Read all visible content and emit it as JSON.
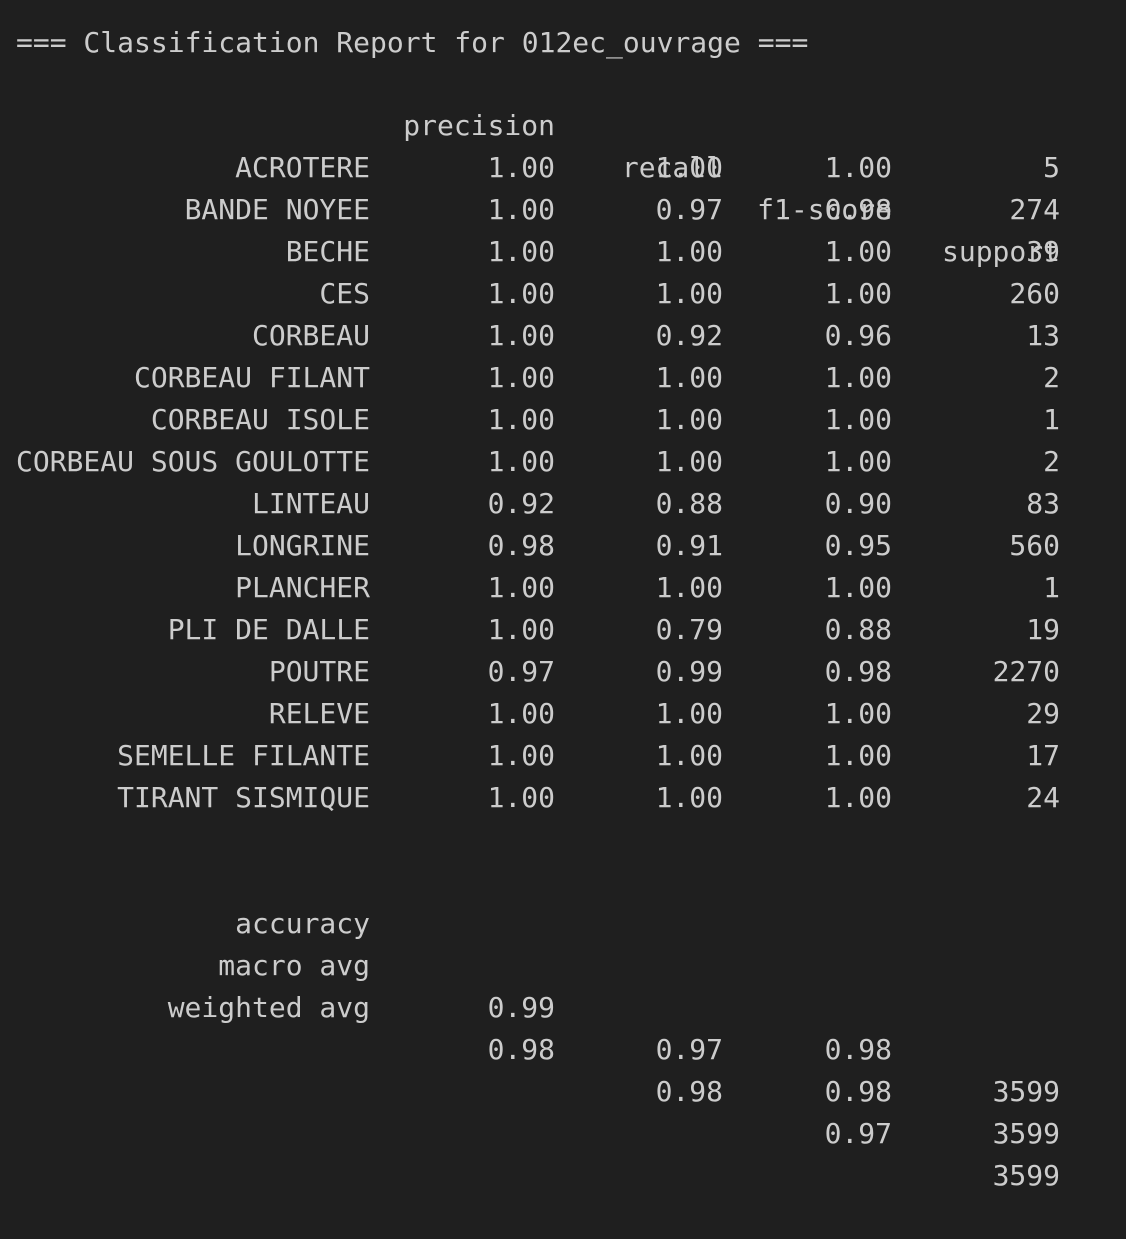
{
  "title": "=== Classification Report for 012ec_ouvrage ===",
  "headers": {
    "precision": "precision",
    "recall": "recall",
    "f1": "f1-score",
    "support": "support"
  },
  "rows": [
    {
      "label": "ACROTERE",
      "precision": "1.00",
      "recall": "1.00",
      "f1": "1.00",
      "support": "5"
    },
    {
      "label": "BANDE NOYEE",
      "precision": "1.00",
      "recall": "0.97",
      "f1": "0.98",
      "support": "274"
    },
    {
      "label": "BECHE",
      "precision": "1.00",
      "recall": "1.00",
      "f1": "1.00",
      "support": "39"
    },
    {
      "label": "CES",
      "precision": "1.00",
      "recall": "1.00",
      "f1": "1.00",
      "support": "260"
    },
    {
      "label": "CORBEAU",
      "precision": "1.00",
      "recall": "0.92",
      "f1": "0.96",
      "support": "13"
    },
    {
      "label": "CORBEAU FILANT",
      "precision": "1.00",
      "recall": "1.00",
      "f1": "1.00",
      "support": "2"
    },
    {
      "label": "CORBEAU ISOLE",
      "precision": "1.00",
      "recall": "1.00",
      "f1": "1.00",
      "support": "1"
    },
    {
      "label": "CORBEAU SOUS GOULOTTE",
      "precision": "1.00",
      "recall": "1.00",
      "f1": "1.00",
      "support": "2"
    },
    {
      "label": "LINTEAU",
      "precision": "0.92",
      "recall": "0.88",
      "f1": "0.90",
      "support": "83"
    },
    {
      "label": "LONGRINE",
      "precision": "0.98",
      "recall": "0.91",
      "f1": "0.95",
      "support": "560"
    },
    {
      "label": "PLANCHER",
      "precision": "1.00",
      "recall": "1.00",
      "f1": "1.00",
      "support": "1"
    },
    {
      "label": "PLI DE DALLE",
      "precision": "1.00",
      "recall": "0.79",
      "f1": "0.88",
      "support": "19"
    },
    {
      "label": "POUTRE",
      "precision": "0.97",
      "recall": "0.99",
      "f1": "0.98",
      "support": "2270"
    },
    {
      "label": "RELEVE",
      "precision": "1.00",
      "recall": "1.00",
      "f1": "1.00",
      "support": "29"
    },
    {
      "label": "SEMELLE FILANTE",
      "precision": "1.00",
      "recall": "1.00",
      "f1": "1.00",
      "support": "17"
    },
    {
      "label": "TIRANT SISMIQUE",
      "precision": "1.00",
      "recall": "1.00",
      "f1": "1.00",
      "support": "24"
    }
  ],
  "summary": {
    "accuracy": {
      "label": "accuracy",
      "precision": "",
      "recall": "",
      "f1": "0.98",
      "support": "3599"
    },
    "macro": {
      "label": "macro avg",
      "precision": "0.99",
      "recall": "0.97",
      "f1": "0.98",
      "support": "3599"
    },
    "weighted": {
      "label": "weighted avg",
      "precision": "0.98",
      "recall": "0.98",
      "f1": "0.97",
      "support": "3599"
    }
  },
  "colors": {
    "background": "#1f1f1f",
    "text": "#cccccc"
  }
}
